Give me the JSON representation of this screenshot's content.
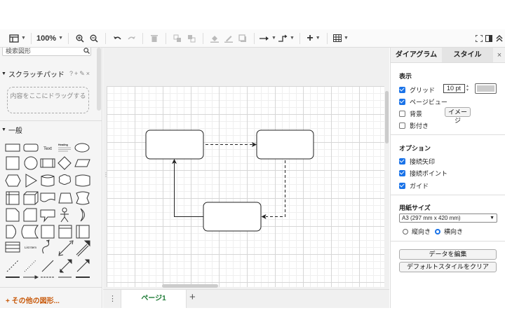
{
  "toolbar": {
    "zoom": "100%"
  },
  "sidebar": {
    "search_placeholder": "検索図形",
    "scratchpad_title": "スクラッチパッド",
    "scratchpad_actions": "?+✎×",
    "scratchpad_drop": "内容をここにドラッグする",
    "general_title": "一般",
    "shape_text_label": "Text",
    "shape_heading_label": "Heading",
    "shape_listitem_label": "List Item",
    "more_shapes": "+ その他の図形..."
  },
  "canvas": {
    "page_tab": "ページ1",
    "add_page": "+"
  },
  "format_panel": {
    "tab_diagram": "ダイアグラム",
    "tab_style": "スタイル",
    "close": "×",
    "section_view": "表示",
    "grid_label": "グリッド",
    "grid_size": "10 pt",
    "grid_color": "#cccccc",
    "page_view_label": "ページビュー",
    "background_label": "背景",
    "image_button": "イメージ",
    "shadow_label": "影付き",
    "section_options": "オプション",
    "connection_arrows_label": "接続矢印",
    "connection_points_label": "接続ポイント",
    "guides_label": "ガイド",
    "section_paper": "用紙サイズ",
    "paper_size": "A3 (297 mm x 420 mm)",
    "portrait_label": "縦向き",
    "landscape_label": "横向き",
    "edit_data_button": "データを編集",
    "clear_default_style_button": "デフォルトスタイルをクリア"
  },
  "colors": {
    "accent": "#1a73e8",
    "more_shapes": "#c8590a",
    "page_tab": "#1e7b36"
  }
}
